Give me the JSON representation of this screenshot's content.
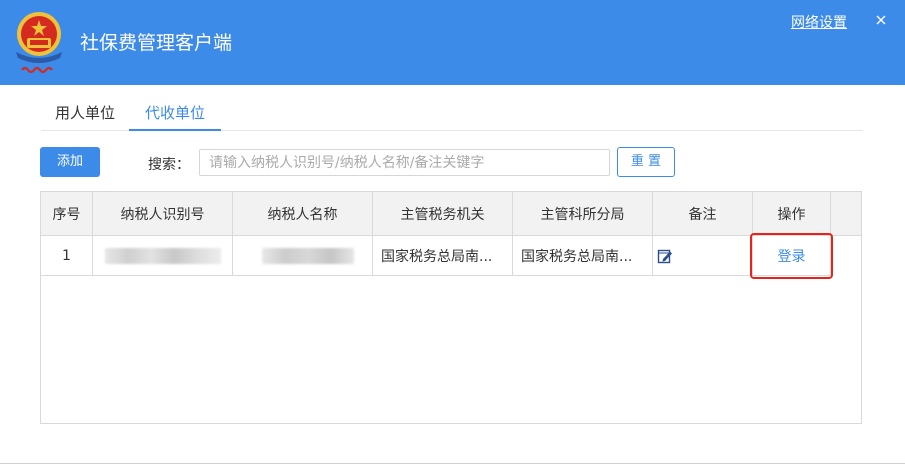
{
  "window": {
    "title": "社保费管理客户端",
    "network_settings": "网络设置",
    "close_symbol": "×"
  },
  "tabs": [
    {
      "label": "用人单位",
      "active": false
    },
    {
      "label": "代收单位",
      "active": true
    }
  ],
  "toolbar": {
    "add_label": "添加",
    "search_label": "搜索：",
    "search_placeholder": "请输入纳税人识别号/纳税人名称/备注关键字",
    "search_value": "",
    "reset_label": "重 置"
  },
  "table": {
    "columns": [
      "序号",
      "纳税人识别号",
      "纳税人名称",
      "主管税务机关",
      "主管科所分局",
      "备注",
      "操作"
    ],
    "rows": [
      {
        "index": "1",
        "taxpayer_id": "",
        "taxpayer_name": "",
        "tax_authority": "国家税务总局南...",
        "tax_branch": "国家税务总局南...",
        "remark_icon": "edit-note-icon",
        "action": "登录"
      }
    ]
  },
  "colors": {
    "primary": "#3d8be8",
    "highlight": "#e8231c",
    "emblem_red": "#d42a20",
    "emblem_gold": "#f0c23a"
  },
  "icons": {
    "logo": "tax-emblem-icon",
    "close": "close-icon",
    "remark": "edit-note-icon"
  }
}
